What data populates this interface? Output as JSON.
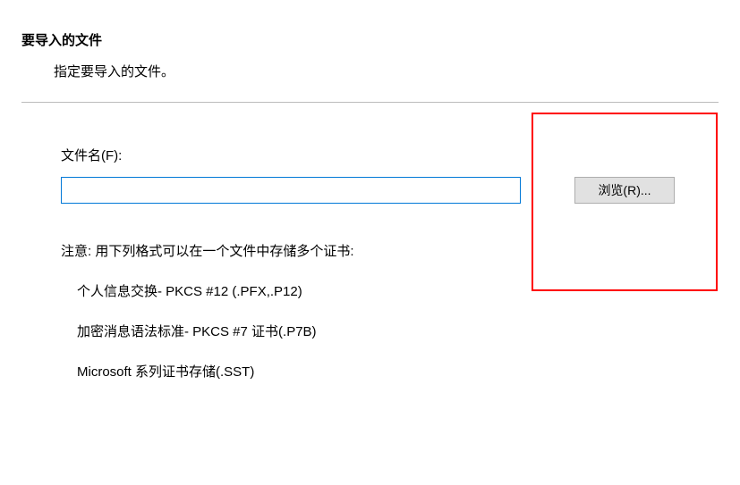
{
  "header": {
    "title": "要导入的文件",
    "subtitle": "指定要导入的文件。"
  },
  "form": {
    "filename_label": "文件名(F):",
    "filename_value": "",
    "browse_button": "浏览(R)..."
  },
  "note": {
    "text": "注意: 用下列格式可以在一个文件中存储多个证书:",
    "formats": [
      "个人信息交换- PKCS #12 (.PFX,.P12)",
      "加密消息语法标准- PKCS #7 证书(.P7B)",
      "Microsoft 系列证书存储(.SST)"
    ]
  }
}
